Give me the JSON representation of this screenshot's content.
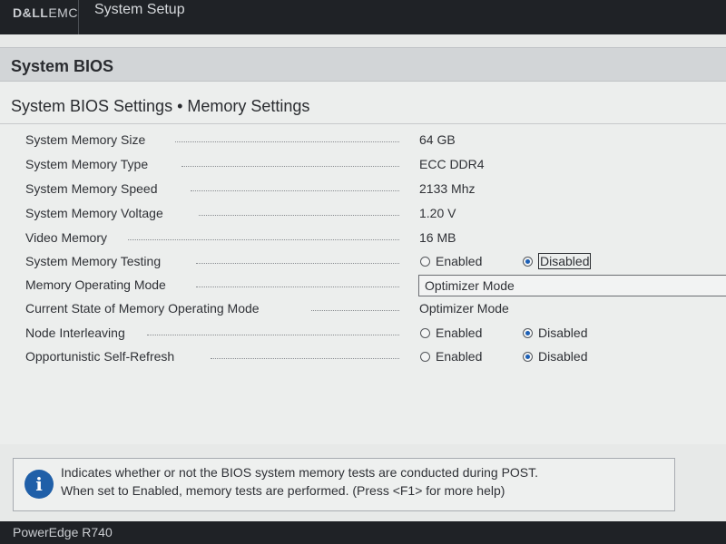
{
  "header": {
    "brand_bold": "D&LL",
    "brand_rest": "EMC",
    "app_title": "System Setup"
  },
  "section": {
    "title": "System BIOS"
  },
  "page": {
    "title": "System BIOS Settings • Memory Settings"
  },
  "settings": [
    {
      "label": "System Memory Size",
      "value": "64 GB"
    },
    {
      "label": "System Memory Type",
      "value": "ECC DDR4"
    },
    {
      "label": "System Memory Speed",
      "value": "2133 Mhz"
    },
    {
      "label": "System Memory Voltage",
      "value": "1.20 V"
    },
    {
      "label": "Video Memory",
      "value": "16 MB"
    },
    {
      "label": "System Memory Testing",
      "option_enabled": "Enabled",
      "option_disabled": "Disabled",
      "selected": "Disabled"
    },
    {
      "label": "Memory Operating Mode",
      "dropdown_value": "Optimizer Mode"
    },
    {
      "label": "Current State of Memory Operating Mode",
      "value": "Optimizer Mode"
    },
    {
      "label": "Node Interleaving",
      "option_enabled": "Enabled",
      "option_disabled": "Disabled",
      "selected": "Disabled"
    },
    {
      "label": "Opportunistic Self-Refresh",
      "option_enabled": "Enabled",
      "option_disabled": "Disabled",
      "selected": "Disabled"
    }
  ],
  "help": {
    "icon": "info-icon",
    "line1": "Indicates whether or not the BIOS system memory tests are conducted during POST.",
    "line2": "When set to Enabled, memory tests are performed. (Press <F1> for more help)"
  },
  "footer": {
    "model": "PowerEdge R740"
  },
  "colors": {
    "top_bar": "#1f2226",
    "selection": "#1c5fb5",
    "info_icon": "#1f5fa8"
  }
}
